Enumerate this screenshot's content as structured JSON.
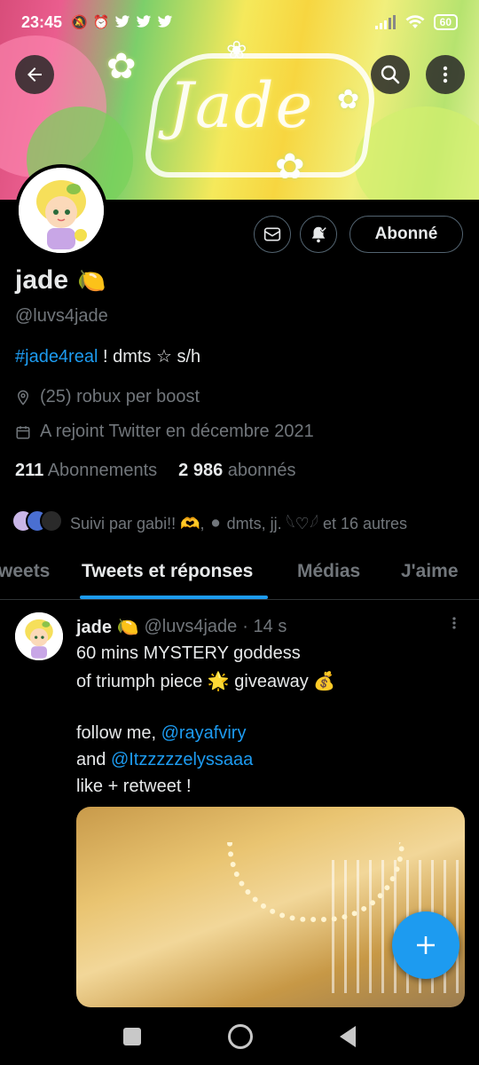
{
  "status_bar": {
    "time": "23:45",
    "battery": "60"
  },
  "banner": {
    "art_text": "Jade",
    "colors": [
      "#d84d7a",
      "#f5e95b",
      "#7ccf6a"
    ]
  },
  "profile": {
    "name": "jade",
    "name_emoji": "🍋",
    "handle": "@luvs4jade",
    "bio_tag": "#jade4real",
    "bio_rest": " ! dmts ☆ s/h",
    "location": "(25) robux per boost",
    "joined": "A rejoint Twitter en décembre 2021",
    "following_count": "211",
    "following_label": "Abonnements",
    "followers_count": "2 986",
    "followers_label": "abonnés",
    "followed_by": "Suivi par gabi!! 🫶, ⚫ dmts, jj. 𓆩♡𓆪 et 16 autres"
  },
  "buttons": {
    "follow": "Abonné"
  },
  "tabs": [
    "weets",
    "Tweets et réponses",
    "Médias",
    "J'aime"
  ],
  "tweet": {
    "author": "jade 🍋",
    "handle": "@luvs4jade",
    "time": "· 14 s",
    "line1": "60 mins MYSTERY goddess",
    "line2": "of triumph piece 🌟 giveaway 💰",
    "line3_pre": "follow me, ",
    "line3_link": "@rayafviry",
    "line4_pre": "and ",
    "line4_link": "@Itzzzzzelyssaaa",
    "line5": "like + retweet !"
  },
  "accent_color": "#1d9bf0"
}
